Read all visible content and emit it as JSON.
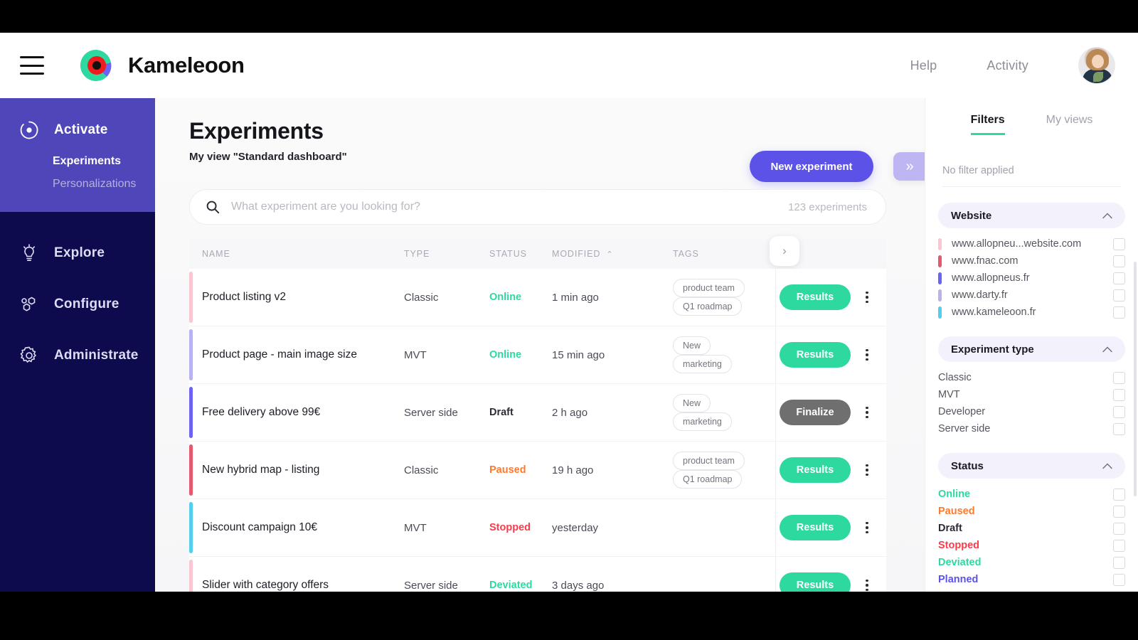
{
  "topbar": {
    "menu_icon": "hamburger-icon",
    "brand": "Kameleoon",
    "links": [
      {
        "label": "Help"
      },
      {
        "label": "Activity"
      }
    ],
    "avatar_alt": "user-avatar"
  },
  "sidebar": {
    "activate": {
      "label": "Activate",
      "icon": "target-icon",
      "sub_items": [
        {
          "label": "Experiments",
          "active": true
        },
        {
          "label": "Personalizations",
          "active": false
        }
      ]
    },
    "items": [
      {
        "label": "Explore",
        "icon": "lightbulb-icon"
      },
      {
        "label": "Configure",
        "icon": "nodes-icon"
      },
      {
        "label": "Administrate",
        "icon": "gear-icon"
      }
    ]
  },
  "main": {
    "title": "Experiments",
    "subtitle": "My view \"Standard dashboard\"",
    "new_experiment_label": "New experiment",
    "panel_toggle_icon": "chevron-double-right-icon",
    "search": {
      "placeholder": "What experiment are you looking for?",
      "value": "",
      "count_label": "123 experiments",
      "icon": "search-icon"
    },
    "table": {
      "next_col_icon": "chevron-right-icon",
      "columns": [
        {
          "key": "name",
          "label": "NAME"
        },
        {
          "key": "type",
          "label": "TYPE"
        },
        {
          "key": "status",
          "label": "STATUS"
        },
        {
          "key": "modified",
          "label": "MODIFIED",
          "sorted": true,
          "sort_caret": "⌃"
        },
        {
          "key": "tags",
          "label": "TAGS"
        }
      ],
      "rows": [
        {
          "name": "Product listing v2",
          "type": "Classic",
          "status": "Online",
          "status_color": "#2ed9a0",
          "modified": "1 min ago",
          "tags": [
            "product team",
            "Q1 roadmap"
          ],
          "accent": "#f9c6d1",
          "action": "Results",
          "action_kind": "results"
        },
        {
          "name": "Product page - main image size",
          "type": "MVT",
          "status": "Online",
          "status_color": "#2ed9a0",
          "modified": "15 min ago",
          "tags": [
            "New",
            "marketing"
          ],
          "accent": "#b6b3f0",
          "action": "Results",
          "action_kind": "results"
        },
        {
          "name": "Free delivery above 99€",
          "type": "Server side",
          "status": "Draft",
          "status_color": "#2c2c35",
          "modified": "2 h ago",
          "tags": [
            "New",
            "marketing"
          ],
          "accent": "#6c63f5",
          "action": "Finalize",
          "action_kind": "finalize"
        },
        {
          "name": "New hybrid map - listing",
          "type": "Classic",
          "status": "Paused",
          "status_color": "#ff7a2f",
          "modified": "19 h ago",
          "tags": [
            "product team",
            "Q1 roadmap"
          ],
          "accent": "#e4596e",
          "action": "Results",
          "action_kind": "results"
        },
        {
          "name": "Discount campaign 10€",
          "type": "MVT",
          "status": "Stopped",
          "status_color": "#fb3b4a",
          "modified": "yesterday",
          "tags": [],
          "accent": "#55cdec",
          "action": "Results",
          "action_kind": "results"
        },
        {
          "name": "Slider with category offers",
          "type": "Server side",
          "status": "Deviated",
          "status_color": "#2ed9a0",
          "modified": "3 days ago",
          "tags": [],
          "accent": "#f9c6d1",
          "action": "Results",
          "action_kind": "results"
        }
      ]
    }
  },
  "rightpanel": {
    "tabs": [
      {
        "label": "Filters",
        "active": true
      },
      {
        "label": "My views",
        "active": false
      }
    ],
    "no_filter_text": "No filter applied",
    "sections": [
      {
        "title": "Website",
        "caret_icon": "chevron-up-icon",
        "options": [
          {
            "label": "www.allopneu...website.com",
            "swatch": "#f9c6d1",
            "checked": false
          },
          {
            "label": "www.fnac.com",
            "swatch": "#e4596e",
            "checked": false
          },
          {
            "label": "www.allopneus.fr",
            "swatch": "#6c63f5",
            "checked": false
          },
          {
            "label": "www.darty.fr",
            "swatch": "#b6b3f0",
            "checked": false
          },
          {
            "label": "www.kameleoon.fr",
            "swatch": "#55cdec",
            "checked": false
          }
        ]
      },
      {
        "title": "Experiment type",
        "caret_icon": "chevron-up-icon",
        "options": [
          {
            "label": "Classic",
            "swatch": null,
            "checked": false
          },
          {
            "label": "MVT",
            "swatch": null,
            "checked": false
          },
          {
            "label": "Developer",
            "swatch": null,
            "checked": false
          },
          {
            "label": "Server side",
            "swatch": null,
            "checked": false
          }
        ]
      },
      {
        "title": "Status",
        "caret_icon": "chevron-up-icon",
        "options": [
          {
            "label": "Online",
            "swatch": null,
            "checked": false,
            "color": "#2ed9a0",
            "bold": true
          },
          {
            "label": "Paused",
            "swatch": null,
            "checked": false,
            "color": "#ff7a2f",
            "bold": true
          },
          {
            "label": "Draft",
            "swatch": null,
            "checked": false,
            "color": "#2c2c35",
            "bold": true
          },
          {
            "label": "Stopped",
            "swatch": null,
            "checked": false,
            "color": "#fb3b4a",
            "bold": true
          },
          {
            "label": "Deviated",
            "swatch": null,
            "checked": false,
            "color": "#2ed9a0",
            "bold": true
          },
          {
            "label": "Planned",
            "swatch": null,
            "checked": false,
            "color": "#5c52e8",
            "bold": true
          }
        ]
      }
    ]
  }
}
